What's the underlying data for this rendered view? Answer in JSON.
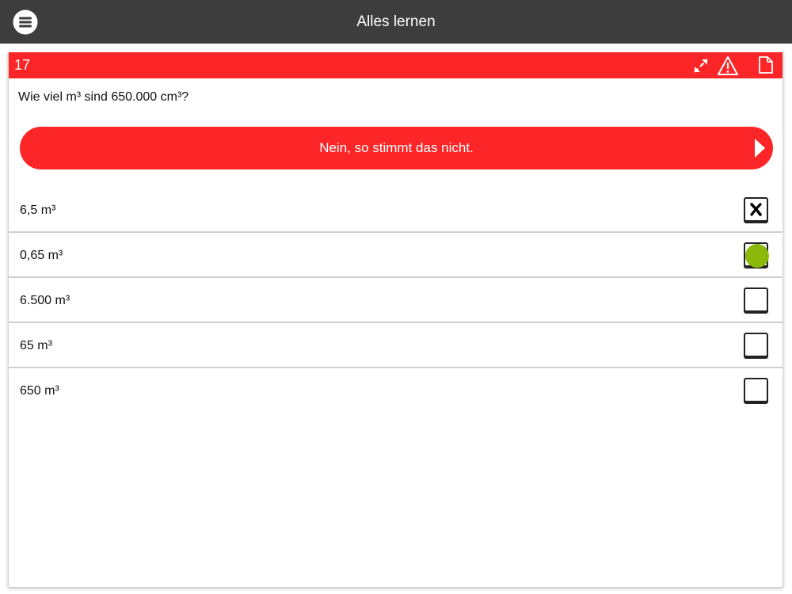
{
  "header": {
    "title": "Alles lernen",
    "menu_icon": "hamburger-menu-icon",
    "background": "#3d3d3d"
  },
  "card": {
    "question_number": "17",
    "header_color": "#fc2527",
    "icons": [
      "expand-arrows-icon",
      "warning-icon",
      "note-icon"
    ]
  },
  "question": {
    "text": "Wie viel m³ sind 650.000 cm³?"
  },
  "feedback": {
    "text": "Nein, so stimmt das nicht.",
    "color": "#fc2527"
  },
  "answers": [
    {
      "label": "6,5 m³",
      "state": "selected-wrong"
    },
    {
      "label": "0,65 m³",
      "state": "correct"
    },
    {
      "label": "6.500 m³",
      "state": "unchecked"
    },
    {
      "label": "65 m³",
      "state": "unchecked"
    },
    {
      "label": "650 m³",
      "state": "unchecked"
    }
  ],
  "colors": {
    "correct_marker": "#8cb80a"
  }
}
